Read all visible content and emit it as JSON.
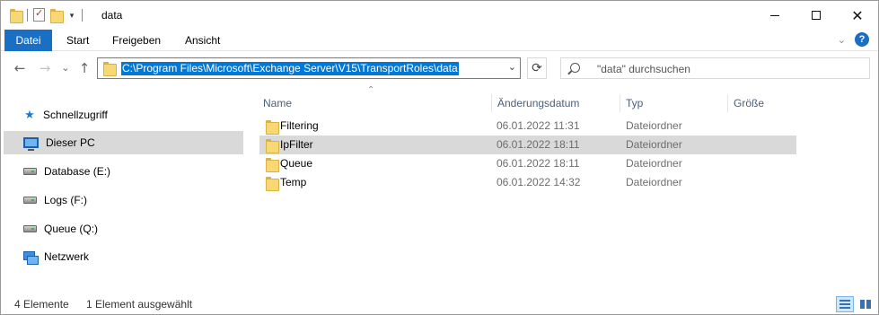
{
  "window": {
    "title": "data",
    "controls": {
      "minimize": "—",
      "maximize": "□",
      "close": "✕"
    }
  },
  "ribbon": {
    "tabs": [
      "Datei",
      "Start",
      "Freigeben",
      "Ansicht"
    ],
    "help": "?"
  },
  "nav": {
    "back": "←",
    "forward": "→",
    "recent": "⌄",
    "up": "↑",
    "address": "C:\\Program Files\\Microsoft\\Exchange Server\\V15\\TransportRoles\\data",
    "refresh": "⟳",
    "search_placeholder": "\"data\" durchsuchen"
  },
  "sidebar": {
    "items": [
      {
        "label": "Schnellzugriff",
        "icon": "star-icon"
      },
      {
        "label": "Dieser PC",
        "icon": "pc-icon",
        "selected": true
      },
      {
        "label": "Database (E:)",
        "icon": "drive-icon"
      },
      {
        "label": "Logs (F:)",
        "icon": "drive-icon"
      },
      {
        "label": "Queue (Q:)",
        "icon": "drive-icon"
      },
      {
        "label": "Netzwerk",
        "icon": "network-icon"
      }
    ]
  },
  "columns": {
    "name": "Name",
    "date": "Änderungsdatum",
    "type": "Typ",
    "size": "Größe"
  },
  "rows": [
    {
      "name": "Filtering",
      "date": "06.01.2022 11:31",
      "type": "Dateiordner",
      "selected": false
    },
    {
      "name": "IpFilter",
      "date": "06.01.2022 18:11",
      "type": "Dateiordner",
      "selected": true
    },
    {
      "name": "Queue",
      "date": "06.01.2022 18:11",
      "type": "Dateiordner",
      "selected": false
    },
    {
      "name": "Temp",
      "date": "06.01.2022 14:32",
      "type": "Dateiordner",
      "selected": false
    }
  ],
  "status": {
    "count": "4 Elemente",
    "selection": "1 Element ausgewählt"
  },
  "colors": {
    "accent": "#1a6fc4",
    "selection": "#d9d9d9",
    "address_highlight": "#0078d7"
  }
}
